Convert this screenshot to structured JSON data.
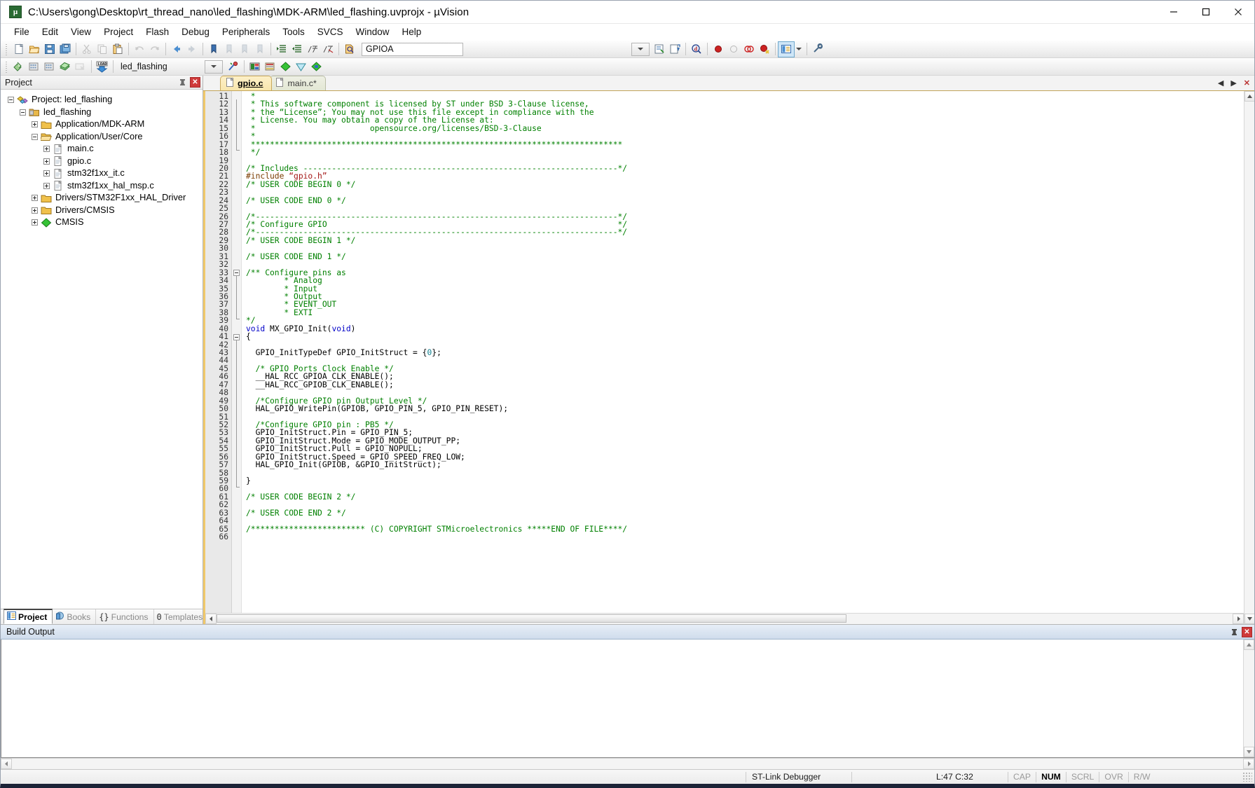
{
  "window": {
    "title": "C:\\Users\\gong\\Desktop\\rt_thread_nano\\led_flashing\\MDK-ARM\\led_flashing.uvprojx - µVision",
    "app_icon": "uvision-icon",
    "minimize": "—",
    "maximize": "☐",
    "close": "✕"
  },
  "menu": {
    "items": [
      "File",
      "Edit",
      "View",
      "Project",
      "Flash",
      "Debug",
      "Peripherals",
      "Tools",
      "SVCS",
      "Window",
      "Help"
    ]
  },
  "toolbar_main": {
    "buttons": [
      "new-file-icon",
      "open-file-icon",
      "save-icon",
      "save-all-icon",
      "cut-icon",
      "copy-icon",
      "paste-icon",
      "undo-icon",
      "redo-icon",
      "navigate-back-icon",
      "navigate-forward-icon",
      "bookmark-toggle-icon",
      "bookmark-prev-icon",
      "bookmark-next-icon",
      "bookmark-clear-icon",
      "indent-icon",
      "outdent-icon",
      "comment-icon",
      "uncomment-icon",
      "find-in-files-icon"
    ],
    "search_value": "GPIOA",
    "search_placeholder": "",
    "right_buttons": [
      "incremental-find-icon",
      "bookmark-find-icon",
      "find-next-icon",
      "debug-stop-icon",
      "breakpoint-insert-icon",
      "breakpoint-disable-icon",
      "breakpoint-disable-all-icon",
      "breakpoint-kill-all-icon",
      "project-window-icon",
      "configure-icon"
    ]
  },
  "toolbar_build": {
    "buttons": [
      "translate-icon",
      "build-icon",
      "rebuild-icon",
      "batch-build-icon",
      "stop-build-icon",
      "download-icon"
    ],
    "target_value": "led_flashing",
    "right_buttons": [
      "target-options-icon",
      "manage-project-items-icon",
      "books-icon",
      "pack-installer-icon",
      "run-to-main-icon",
      "manage-runtime-icon"
    ]
  },
  "project_panel": {
    "title": "Project",
    "pin_icon": "pin-icon",
    "close_icon": "close-icon",
    "tree": [
      {
        "indent": 0,
        "toggle": "minus",
        "icon": "project-icon",
        "label": "Project: led_flashing"
      },
      {
        "indent": 1,
        "toggle": "minus",
        "icon": "target-icon",
        "label": "led_flashing"
      },
      {
        "indent": 2,
        "toggle": "plus",
        "icon": "folder-icon",
        "label": "Application/MDK-ARM"
      },
      {
        "indent": 2,
        "toggle": "minus",
        "icon": "folder-open-icon",
        "label": "Application/User/Core"
      },
      {
        "indent": 3,
        "toggle": "plus",
        "icon": "file-c-icon",
        "label": "main.c"
      },
      {
        "indent": 3,
        "toggle": "plus",
        "icon": "file-c-icon",
        "label": "gpio.c"
      },
      {
        "indent": 3,
        "toggle": "plus",
        "icon": "file-c-icon",
        "label": "stm32f1xx_it.c"
      },
      {
        "indent": 3,
        "toggle": "plus",
        "icon": "file-c-icon",
        "label": "stm32f1xx_hal_msp.c"
      },
      {
        "indent": 2,
        "toggle": "plus",
        "icon": "folder-icon",
        "label": "Drivers/STM32F1xx_HAL_Driver"
      },
      {
        "indent": 2,
        "toggle": "plus",
        "icon": "folder-icon",
        "label": "Drivers/CMSIS"
      },
      {
        "indent": 2,
        "toggle": "plus",
        "icon": "cmsis-icon",
        "label": "CMSIS"
      }
    ],
    "bottom_tabs": [
      {
        "label": "Project",
        "icon": "project-tab-icon",
        "selected": true
      },
      {
        "label": "Books",
        "icon": "books-tab-icon",
        "selected": false
      },
      {
        "label": "Functions",
        "icon": "functions-tab-icon",
        "selected": false
      },
      {
        "label": "Templates",
        "icon": "templates-tab-icon",
        "selected": false
      }
    ]
  },
  "editor": {
    "tabs": [
      {
        "label": "gpio.c",
        "active": true,
        "icon": "file-icon"
      },
      {
        "label": "main.c*",
        "active": false,
        "icon": "file-icon"
      }
    ],
    "tab_scroll_left": "◀",
    "tab_scroll_right": "▶",
    "tab_close": "✕",
    "first_line": 11,
    "lines": [
      {
        "n": 11,
        "segs": [
          [
            "cmt",
            " *"
          ]
        ]
      },
      {
        "n": 12,
        "segs": [
          [
            "cmt",
            " * This software component is licensed by ST under BSD 3-Clause license,"
          ]
        ]
      },
      {
        "n": 13,
        "segs": [
          [
            "cmt",
            " * the “License”; You may not use this file except in compliance with the"
          ]
        ]
      },
      {
        "n": 14,
        "segs": [
          [
            "cmt",
            " * License. You may obtain a copy of the License at:"
          ]
        ]
      },
      {
        "n": 15,
        "segs": [
          [
            "cmt",
            " *                        opensource.org/licenses/BSD-3-Clause"
          ]
        ]
      },
      {
        "n": 16,
        "segs": [
          [
            "cmt",
            " *"
          ]
        ]
      },
      {
        "n": 17,
        "segs": [
          [
            "cmt",
            " ******************************************************************************"
          ]
        ]
      },
      {
        "n": 18,
        "segs": [
          [
            "cmt",
            " */"
          ]
        ]
      },
      {
        "n": 19,
        "segs": [
          [
            "plain",
            ""
          ]
        ]
      },
      {
        "n": 20,
        "segs": [
          [
            "cmt",
            "/* Includes ------------------------------------------------------------------*/"
          ]
        ]
      },
      {
        "n": 21,
        "segs": [
          [
            "pp",
            "#include "
          ],
          [
            "str",
            "“gpio.h”"
          ]
        ]
      },
      {
        "n": 22,
        "segs": [
          [
            "cmt",
            "/* USER CODE BEGIN 0 */"
          ]
        ]
      },
      {
        "n": 23,
        "segs": [
          [
            "plain",
            ""
          ]
        ]
      },
      {
        "n": 24,
        "segs": [
          [
            "cmt",
            "/* USER CODE END 0 */"
          ]
        ]
      },
      {
        "n": 25,
        "segs": [
          [
            "plain",
            ""
          ]
        ]
      },
      {
        "n": 26,
        "segs": [
          [
            "cmt",
            "/*----------------------------------------------------------------------------*/"
          ]
        ]
      },
      {
        "n": 27,
        "segs": [
          [
            "cmt",
            "/* Configure GPIO                                                             */"
          ]
        ]
      },
      {
        "n": 28,
        "segs": [
          [
            "cmt",
            "/*----------------------------------------------------------------------------*/"
          ]
        ]
      },
      {
        "n": 29,
        "segs": [
          [
            "cmt",
            "/* USER CODE BEGIN 1 */"
          ]
        ]
      },
      {
        "n": 30,
        "segs": [
          [
            "plain",
            ""
          ]
        ]
      },
      {
        "n": 31,
        "segs": [
          [
            "cmt",
            "/* USER CODE END 1 */"
          ]
        ]
      },
      {
        "n": 32,
        "segs": [
          [
            "plain",
            ""
          ]
        ]
      },
      {
        "n": 33,
        "segs": [
          [
            "cmt",
            "/** Configure pins as"
          ]
        ]
      },
      {
        "n": 34,
        "segs": [
          [
            "cmt",
            "        * Analog"
          ]
        ]
      },
      {
        "n": 35,
        "segs": [
          [
            "cmt",
            "        * Input"
          ]
        ]
      },
      {
        "n": 36,
        "segs": [
          [
            "cmt",
            "        * Output"
          ]
        ]
      },
      {
        "n": 37,
        "segs": [
          [
            "cmt",
            "        * EVENT_OUT"
          ]
        ]
      },
      {
        "n": 38,
        "segs": [
          [
            "cmt",
            "        * EXTI"
          ]
        ]
      },
      {
        "n": 39,
        "segs": [
          [
            "cmt",
            "*/"
          ]
        ]
      },
      {
        "n": 40,
        "segs": [
          [
            "kw",
            "void"
          ],
          [
            "plain",
            " MX_GPIO_Init("
          ],
          [
            "kw",
            "void"
          ],
          [
            "plain",
            ")"
          ]
        ]
      },
      {
        "n": 41,
        "segs": [
          [
            "plain",
            "{"
          ]
        ]
      },
      {
        "n": 42,
        "segs": [
          [
            "plain",
            ""
          ]
        ]
      },
      {
        "n": 43,
        "segs": [
          [
            "plain",
            "  GPIO_InitTypeDef GPIO_InitStruct = {"
          ],
          [
            "num",
            "0"
          ],
          [
            "plain",
            "};"
          ]
        ]
      },
      {
        "n": 44,
        "segs": [
          [
            "plain",
            ""
          ]
        ]
      },
      {
        "n": 45,
        "segs": [
          [
            "cmt",
            "  /* GPIO Ports Clock Enable */"
          ]
        ]
      },
      {
        "n": 46,
        "segs": [
          [
            "plain",
            "  __HAL_RCC_GPIOA_CLK_ENABLE();"
          ]
        ]
      },
      {
        "n": 47,
        "segs": [
          [
            "plain",
            "  __HAL_RCC_GPIOB_CLK_ENABLE();"
          ]
        ]
      },
      {
        "n": 48,
        "segs": [
          [
            "plain",
            ""
          ]
        ]
      },
      {
        "n": 49,
        "segs": [
          [
            "cmt",
            "  /*Configure GPIO pin Output Level */"
          ]
        ]
      },
      {
        "n": 50,
        "segs": [
          [
            "plain",
            "  HAL_GPIO_WritePin(GPIOB, GPIO_PIN_5, GPIO_PIN_RESET);"
          ]
        ]
      },
      {
        "n": 51,
        "segs": [
          [
            "plain",
            ""
          ]
        ]
      },
      {
        "n": 52,
        "segs": [
          [
            "cmt",
            "  /*Configure GPIO pin : PB5 */"
          ]
        ]
      },
      {
        "n": 53,
        "segs": [
          [
            "plain",
            "  GPIO_InitStruct.Pin = GPIO_PIN_5;"
          ]
        ]
      },
      {
        "n": 54,
        "segs": [
          [
            "plain",
            "  GPIO_InitStruct.Mode = GPIO_MODE_OUTPUT_PP;"
          ]
        ]
      },
      {
        "n": 55,
        "segs": [
          [
            "plain",
            "  GPIO_InitStruct.Pull = GPIO_NOPULL;"
          ]
        ]
      },
      {
        "n": 56,
        "segs": [
          [
            "plain",
            "  GPIO_InitStruct.Speed = GPIO_SPEED_FREQ_LOW;"
          ]
        ]
      },
      {
        "n": 57,
        "segs": [
          [
            "plain",
            "  HAL_GPIO_Init(GPIOB, &GPIO_InitStruct);"
          ]
        ]
      },
      {
        "n": 58,
        "segs": [
          [
            "plain",
            ""
          ]
        ]
      },
      {
        "n": 59,
        "segs": [
          [
            "plain",
            "}"
          ]
        ]
      },
      {
        "n": 60,
        "segs": [
          [
            "plain",
            ""
          ]
        ]
      },
      {
        "n": 61,
        "segs": [
          [
            "cmt",
            "/* USER CODE BEGIN 2 */"
          ]
        ]
      },
      {
        "n": 62,
        "segs": [
          [
            "plain",
            ""
          ]
        ]
      },
      {
        "n": 63,
        "segs": [
          [
            "cmt",
            "/* USER CODE END 2 */"
          ]
        ]
      },
      {
        "n": 64,
        "segs": [
          [
            "plain",
            ""
          ]
        ]
      },
      {
        "n": 65,
        "segs": [
          [
            "cmt",
            "/************************ (C) COPYRIGHT STMicroelectronics *****END OF FILE****/"
          ]
        ]
      },
      {
        "n": 66,
        "segs": [
          [
            "plain",
            ""
          ]
        ]
      }
    ]
  },
  "build_output": {
    "title": "Build Output",
    "pin_icon": "pin-icon",
    "close_icon": "close-icon",
    "text": ""
  },
  "status_bar": {
    "debugger": "ST-Link Debugger",
    "middle": "",
    "position": "L:47 C:32",
    "indicators": [
      {
        "label": "CAP",
        "on": false
      },
      {
        "label": "NUM",
        "on": true
      },
      {
        "label": "SCRL",
        "on": false
      },
      {
        "label": "OVR",
        "on": false
      },
      {
        "label": "R/W",
        "on": false
      }
    ]
  },
  "colors": {
    "comment": "#008000",
    "keyword": "#0000c8",
    "string": "#a31515",
    "preproc": "#7a3b00",
    "number": "#0f7f8f",
    "tab_active": "#f8e6ad",
    "accent": "#f0c86a"
  }
}
